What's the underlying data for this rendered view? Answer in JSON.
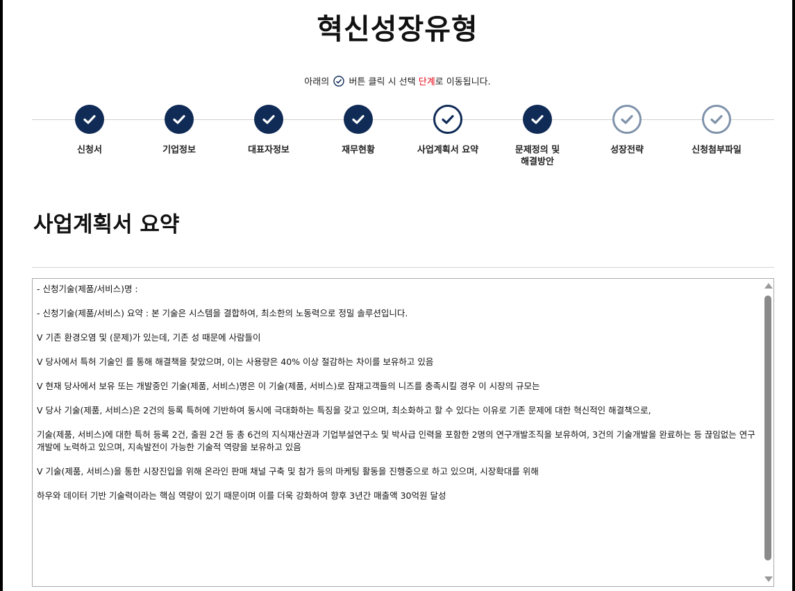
{
  "header": {
    "title": "혁신성장유형"
  },
  "hint": {
    "before": "아래의",
    "after_icon": "버튼 클릭 시 선택",
    "highlight": "단계",
    "after": "로 이동됩니다."
  },
  "steps": [
    {
      "label": "신청서",
      "state": "done"
    },
    {
      "label": "기업정보",
      "state": "done"
    },
    {
      "label": "대표자정보",
      "state": "done"
    },
    {
      "label": "재무현황",
      "state": "done"
    },
    {
      "label": "사업계획서 요약",
      "state": "active"
    },
    {
      "label": "문제정의 및 해결방안",
      "state": "done"
    },
    {
      "label": "성장전략",
      "state": "todo"
    },
    {
      "label": "신청첨부파일",
      "state": "todo"
    }
  ],
  "section": {
    "title": "사업계획서 요약"
  },
  "summary": {
    "paragraphs": [
      "- 신청기술(제품/서비스)명 :",
      "- 신청기술(제품/서비스) 요약 : 본 기술은 시스템을 결합하여, 최소한의 노동력으로 정밀 솔루션입니다.",
      "V 기존 환경오염 및 (문제)가 있는데, 기존 성 때문에 사람들이",
      "V 당사에서 특허 기술인 를 통해 해결책을 찾았으며, 이는 사용량은 40% 이상 절감하는 차이를 보유하고 있음",
      "V 현재 당사에서 보유 또는 개발중인 기술(제품, 서비스)명은 이 기술(제품, 서비스)로 잠재고객들의 니즈를 충족시킬 경우 이 시장의 규모는",
      "V 당사 기술(제품, 서비스)은 2건의 등록 특허에 기반하여 동시에 극대화하는 특징을 갖고 있으며, 최소화하고 할 수 있다는 이유로 기존 문제에 대한 혁신적인 해결책으로,",
      " 기술(제품, 서비스)에 대한 특허 등록 2건, 출원 2건 등 총 6건의 지식재산권과 기업부설연구소 및 박사급 인력을 포함한 2명의 연구개발조직을 보유하여, 3건의 기술개발을 완료하는 등 끊임없는 연구개발에 노력하고 있으며, 지속발전이 가능한 기술적 역량을 보유하고 있음",
      "V 기술(제품, 서비스)을 통한 시장진입을 위해 온라인 판매 채널 구축 및 참가 등의 마케팅 활동을 진행중으로 하고 있으며, 시장확대를 위해",
      "하우와 데이터 기반 기술력이라는 핵심 역량이 있기 때문이며 이를 더욱 강화하여 향후 3년간 매출액 30억원 달성"
    ]
  },
  "colors": {
    "done": "#0f2b56",
    "todo": "#7f92aa",
    "highlight": "#e60012"
  },
  "icons": {
    "step": "check-circle-icon",
    "hint": "check-circle-icon"
  }
}
